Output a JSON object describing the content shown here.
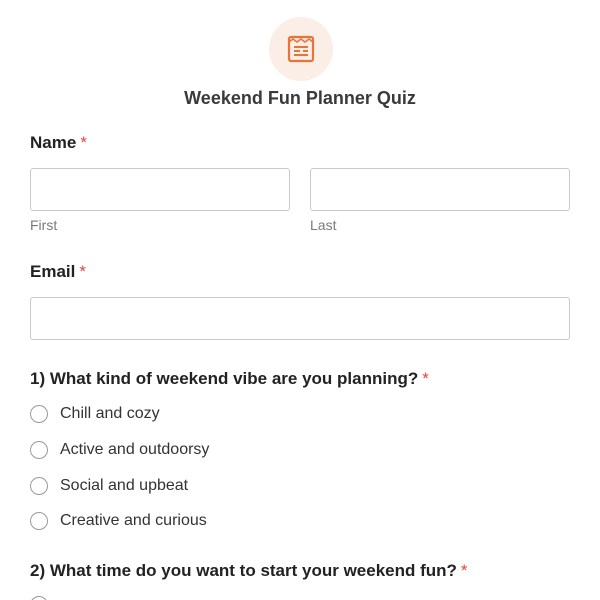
{
  "form": {
    "title": "Weekend Fun Planner Quiz",
    "logo_icon": "form-document-icon",
    "accent_color": "#e8743b",
    "logo_bg_color": "#fbeee6",
    "required_marker": "*",
    "required_color": "#e0463b"
  },
  "name_field": {
    "label": "Name",
    "first_sublabel": "First",
    "last_sublabel": "Last",
    "first_value": "",
    "last_value": ""
  },
  "email_field": {
    "label": "Email",
    "value": ""
  },
  "questions": [
    {
      "label": "1) What kind of weekend vibe are you planning?",
      "options": [
        "Chill and cozy",
        "Active and outdoorsy",
        "Social and upbeat",
        "Creative and curious"
      ]
    },
    {
      "label": "2) What time do you want to start your weekend fun?",
      "options": []
    }
  ]
}
